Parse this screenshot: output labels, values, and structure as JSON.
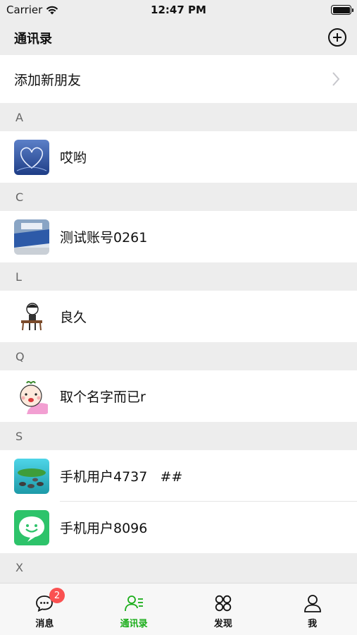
{
  "status": {
    "carrier": "Carrier",
    "time": "12:47 PM"
  },
  "nav": {
    "title": "通讯录"
  },
  "new_friend": {
    "label": "添加新朋友"
  },
  "sections": [
    {
      "letter": "A",
      "contacts": [
        {
          "name": "哎哟",
          "avatar": "blue-heart-photo"
        }
      ]
    },
    {
      "letter": "C",
      "contacts": [
        {
          "name": "测试账号0261",
          "avatar": "baidu-building-photo"
        }
      ]
    },
    {
      "letter": "L",
      "contacts": [
        {
          "name": "良久",
          "avatar": "cartoon-musician"
        }
      ]
    },
    {
      "letter": "Q",
      "contacts": [
        {
          "name": "取个名字而已r",
          "avatar": "cartoon-baby"
        }
      ]
    },
    {
      "letter": "S",
      "contacts": [
        {
          "name": "手机用户4737   ##",
          "avatar": "island-photo"
        },
        {
          "name": "手机用户8096",
          "avatar": "green-smile-chat"
        }
      ]
    },
    {
      "letter": "X",
      "contacts": []
    }
  ],
  "tabs": [
    {
      "label": "消息",
      "icon": "chat-bubble-icon",
      "badge": "2"
    },
    {
      "label": "通讯录",
      "icon": "contacts-icon",
      "active": true
    },
    {
      "label": "发现",
      "icon": "discover-grid-icon"
    },
    {
      "label": "我",
      "icon": "person-icon"
    }
  ],
  "colors": {
    "accent": "#1aad19",
    "badge": "#fa5151",
    "background": "#ededed"
  }
}
